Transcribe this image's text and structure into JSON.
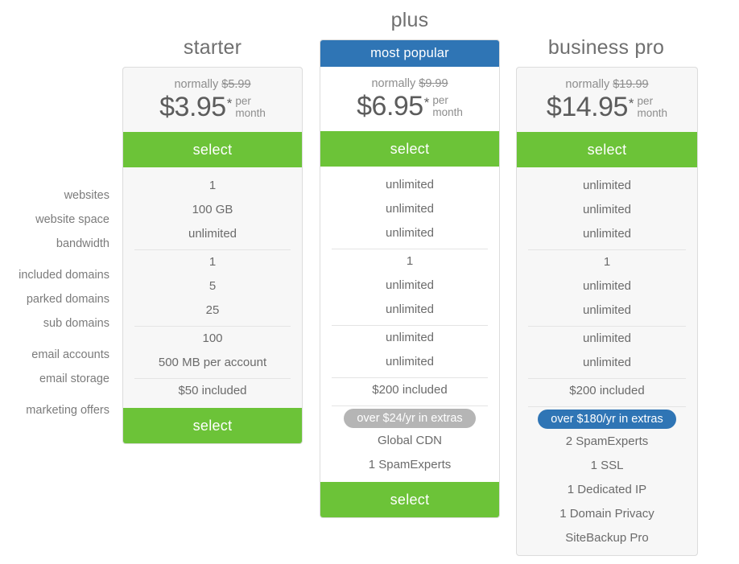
{
  "feature_labels": [
    {
      "label": "websites"
    },
    {
      "label": "website space"
    },
    {
      "label": "bandwidth"
    },
    {
      "label": "included domains"
    },
    {
      "label": "parked domains"
    },
    {
      "label": "sub domains"
    },
    {
      "label": "email accounts"
    },
    {
      "label": "email storage"
    },
    {
      "label": "marketing offers"
    }
  ],
  "plans": {
    "starter": {
      "title": "starter",
      "normally_prefix": "normally ",
      "normally_price": "$5.99",
      "price": "$3.95",
      "star": "*",
      "per": "per",
      "month": "month",
      "select_label": "select",
      "select_bottom_label": "select",
      "groups": [
        {
          "values": [
            "1",
            "100 GB",
            "unlimited"
          ]
        },
        {
          "values": [
            "1",
            "5",
            "25"
          ]
        },
        {
          "values": [
            "100",
            "500 MB per account"
          ]
        },
        {
          "values": [
            "$50 included"
          ]
        }
      ],
      "extras": null
    },
    "plus": {
      "title": "plus",
      "ribbon": "most popular",
      "normally_prefix": "normally ",
      "normally_price": "$9.99",
      "price": "$6.95",
      "star": "*",
      "per": "per",
      "month": "month",
      "select_label": "select",
      "select_bottom_label": "select",
      "groups": [
        {
          "values": [
            "unlimited",
            "unlimited",
            "unlimited"
          ]
        },
        {
          "values": [
            "1",
            "unlimited",
            "unlimited"
          ]
        },
        {
          "values": [
            "unlimited",
            "unlimited"
          ]
        },
        {
          "values": [
            "$200 included"
          ]
        }
      ],
      "extras": {
        "pill": "over $24/yr in extras",
        "pill_color": "#b5b5b5",
        "items": [
          "Global CDN",
          "1 SpamExperts"
        ]
      }
    },
    "bizpro": {
      "title": "business pro",
      "normally_prefix": "normally ",
      "normally_price": "$19.99",
      "price": "$14.95",
      "star": "*",
      "per": "per",
      "month": "month",
      "select_label": "select",
      "groups": [
        {
          "values": [
            "unlimited",
            "unlimited",
            "unlimited"
          ]
        },
        {
          "values": [
            "1",
            "unlimited",
            "unlimited"
          ]
        },
        {
          "values": [
            "unlimited",
            "unlimited"
          ]
        },
        {
          "values": [
            "$200 included"
          ]
        }
      ],
      "extras": {
        "pill": "over $180/yr in extras",
        "pill_color": "#2f75b5",
        "items": [
          "2 SpamExperts",
          "1 SSL",
          "1 Dedicated IP",
          "1 Domain Privacy",
          "SiteBackup Pro"
        ]
      }
    }
  },
  "colors": {
    "green": "#6cc338",
    "blue": "#2f75b5",
    "gray_pill": "#b5b5b5",
    "card_border": "#dcdcdc",
    "card_bg_tinted": "#f7f7f7",
    "card_bg_white": "#ffffff",
    "text_muted": "#7b7b7b",
    "text_value": "#6b6b6b",
    "text_price": "#5c5c5c"
  }
}
